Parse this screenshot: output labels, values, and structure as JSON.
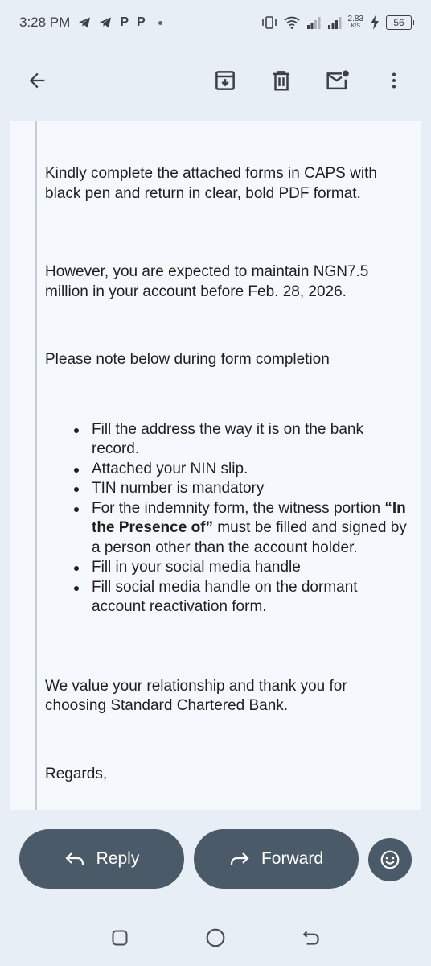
{
  "status": {
    "time": "3:28 PM",
    "notif_letter_1": "P",
    "notif_letter_2": "P",
    "speed_value": "2.83",
    "speed_unit": "K/S",
    "battery": "56"
  },
  "toolbar": {
    "back_icon": "arrow-back-icon",
    "archive_icon": "archive-icon",
    "delete_icon": "trash-icon",
    "mark_unread_icon": "mail-unread-icon",
    "more_icon": "more-vert-icon"
  },
  "email": {
    "para_1": "Kindly complete the attached forms in CAPS with black pen and return in clear, bold PDF format.",
    "para_2": "However, you are expected to maintain NGN7.5 million in your account before Feb. 28, 2026.",
    "para_3": "Please note below during form completion",
    "bullets": {
      "b1": "Fill the address the way it is on the bank record.",
      "b2": "Attached your NIN slip.",
      "b3": "TIN number is mandatory",
      "b4_pre": "For the indemnity form, the witness portion ",
      "b4_bold": "“In the Presence of”",
      "b4_post": " must be filled and signed by a person other than the account holder.",
      "b5": "Fill in your social media handle",
      "b6": "Fill social media handle on the dormant account reactivation form."
    },
    "para_4": "We value your relationship and thank you for choosing Standard Chartered Bank.",
    "para_5": "Regards,"
  },
  "actions": {
    "reply_label": "Reply",
    "forward_label": "Forward"
  },
  "colors": {
    "background": "#e8eef6",
    "card": "#f5f8fd",
    "pill": "#4a5a68"
  }
}
